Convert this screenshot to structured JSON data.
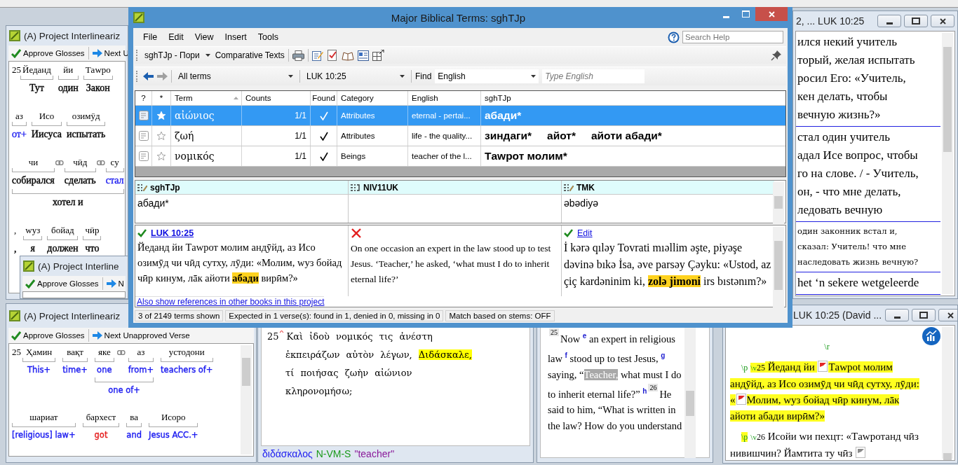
{
  "interlinear_windows": [
    {
      "title": "(A) Project Interlineariz",
      "toolbar": [
        {
          "kind": "approve",
          "label": "Approve Glosses"
        },
        {
          "kind": "next",
          "label": "Next U"
        }
      ],
      "rows": [
        {
          "verse": "25",
          "items": [
            {
              "kind": "word",
              "text": "Йеданд",
              "gloss": "Тут",
              "color": "#000000",
              "linked": false
            },
            {
              "kind": "word",
              "text": "йи",
              "gloss": "один",
              "color": "#000000",
              "linked": false
            },
            {
              "kind": "word",
              "text": "Тawpo",
              "gloss": "Закон",
              "color": "#000000",
              "linked": false
            }
          ]
        },
        {
          "items": [
            {
              "kind": "word",
              "text": "аз",
              "gloss": "от+",
              "color": "#1c1cf0",
              "linked": false
            },
            {
              "kind": "word",
              "text": "Исо",
              "gloss": "Иисуса",
              "color": "#000000",
              "linked": false
            },
            {
              "kind": "word",
              "text": "озимӯд",
              "gloss": "испытать",
              "color": "#000000",
              "linked": false
            }
          ]
        },
        {
          "items": [
            {
              "kind": "phrase",
              "gloss": "хотел и",
              "color": "#000000",
              "words": [
                {
                  "kind": "word",
                  "text": "чи",
                  "gloss": "собирался",
                  "color": "#000000",
                  "linked": true
                },
                {
                  "kind": "word",
                  "text": "чӣд",
                  "gloss": "сделать",
                  "color": "#000000",
                  "linked": true
                },
                {
                  "kind": "word",
                  "text": "су",
                  "gloss": "стал",
                  "color": "#1c1cf0",
                  "linked": false
                }
              ]
            }
          ]
        },
        {
          "items": [
            {
              "kind": "punct",
              "text": ",",
              "gloss": ",",
              "linked": false
            },
            {
              "kind": "word",
              "text": "wуз",
              "gloss": "я",
              "color": "#000000",
              "linked": false
            },
            {
              "kind": "word",
              "text": "бойад",
              "gloss": "должен",
              "color": "#000000",
              "linked": false
            },
            {
              "kind": "word",
              "text": "чӣр",
              "gloss": "что",
              "color": "#000000",
              "linked": false
            }
          ]
        }
      ]
    },
    {
      "title": "(A) Project Interline",
      "toolbar": [
        {
          "kind": "approve",
          "label": "Approve Glosses"
        },
        {
          "kind": "next",
          "label": "N"
        }
      ]
    },
    {
      "title": "(A) Project Interlineariz",
      "toolbar": [
        {
          "kind": "approve",
          "label": "Approve Glosses"
        },
        {
          "kind": "next",
          "label": "Next Unapproved Verse"
        }
      ],
      "rows": [
        {
          "verse": "25",
          "items": [
            {
              "kind": "word",
              "text": "Ҳамин",
              "gloss": "This+",
              "color": "#1c1cf0",
              "linked": false
            },
            {
              "kind": "word",
              "text": "вақт",
              "gloss": "time+",
              "color": "#1c1cf0",
              "linked": false
            },
            {
              "kind": "phrase",
              "gloss": "one of+",
              "color": "#1c1cf0",
              "words": [
                {
                  "kind": "word",
                  "text": "яке",
                  "gloss": "one",
                  "color": "#1c1cf0",
                  "linked": true
                },
                {
                  "kind": "word",
                  "text": "аз",
                  "gloss": "from+",
                  "color": "#1c1cf0",
                  "linked": false
                }
              ]
            },
            {
              "kind": "word",
              "text": "устодони",
              "gloss": "teachers of+",
              "color": "#1c1cf0",
              "linked": false
            }
          ]
        },
        {
          "items": [
            {
              "kind": "word",
              "text": "шариат",
              "gloss": "[religious] law+",
              "color": "#1c1cf0",
              "linked": false
            },
            {
              "kind": "word",
              "text": "бархест",
              "gloss": "got",
              "color": "#e52020",
              "linked": false
            },
            {
              "kind": "word",
              "text": "ва",
              "gloss": "and",
              "color": "#1c1cf0",
              "linked": false
            },
            {
              "kind": "word",
              "text": "Исоро",
              "gloss": "Jesus ACC.+",
              "color": "#1c1cf0",
              "linked": false
            }
          ]
        }
      ]
    }
  ],
  "greek_window": {
    "verse": "25",
    "segments": [
      {
        "text": "Καὶ ἰδοὺ νομικός τις ἀνέστη ἐκπειράζων αὐτὸν λέγων, ",
        "highlighted": false
      },
      {
        "text": "Διδάσκαλε,",
        "highlighted": true
      },
      {
        "text": " τί ποιήσας ζωὴν αἰώνιον κληρονομήσω;",
        "highlighted": false
      }
    ],
    "lexicon": [
      {
        "kind": "lemma",
        "text": "διδάσκαλος"
      },
      {
        "kind": "parsing",
        "text": "N-VM-S"
      },
      {
        "kind": "gloss",
        "text": "\"teacher\""
      }
    ]
  },
  "english_window": {
    "segments": [
      {
        "kind": "verse",
        "text": "25"
      },
      {
        "kind": "text",
        "text": "Now "
      },
      {
        "kind": "note",
        "text": "e"
      },
      {
        "kind": "text",
        "text": " an expert in religious law "
      },
      {
        "kind": "note",
        "text": "f"
      },
      {
        "kind": "text",
        "text": " stood up to test Jesus, "
      },
      {
        "kind": "note",
        "text": "g"
      },
      {
        "kind": "text",
        "text": " saying, “"
      },
      {
        "kind": "selection",
        "text": "Teacher,"
      },
      {
        "kind": "text",
        "text": " what must I do to inherit eternal life?” "
      },
      {
        "kind": "note",
        "text": "h"
      },
      {
        "kind": "verse",
        "text": "26"
      },
      {
        "kind": "text",
        "text": "He said to him, “What is written in the law? How do you understand"
      }
    ]
  },
  "compare_window": {
    "title": "2, ... LUK 10:25",
    "blocks": [
      {
        "kind": "large",
        "lines": [
          "ился некий учитель",
          "торый, желая испытать",
          "росил Его: «Учитель,",
          "кен делать, чтобы",
          "вечную жизнь?»"
        ]
      },
      {
        "kind": "large",
        "lines": [
          "стал один учитель",
          "адал Исе вопрос, чтобы",
          "го на слове. / - Учитель,",
          "он, - что мне делать,",
          "ледовать вечную"
        ]
      },
      {
        "kind": "small",
        "lines": [
          "один законник встал и,",
          "сказал: Учитель! что мне",
          "наследовать жизнь вечную?"
        ]
      },
      {
        "kind": "large",
        "lines": [
          "het ‘n sekere wetgeleerde"
        ]
      }
    ]
  },
  "editor_window": {
    "title": "LUK 10:25 (David ...",
    "paragraphs": [
      {
        "kind": "heading",
        "segments": [
          {
            "kind": "marker",
            "text": "\\r",
            "highlighted": false
          }
        ]
      },
      {
        "kind": "para",
        "segments": [
          {
            "kind": "marker",
            "text": "\\p",
            "highlighted": false
          },
          {
            "kind": "verse",
            "marker": "\\v",
            "text": "25",
            "highlighted": true
          },
          {
            "kind": "text",
            "text": " Йеданд йи ",
            "highlighted": true
          },
          {
            "kind": "flag",
            "color": "#e32626"
          },
          {
            "kind": "text",
            "text": "Тawpot молим андӯйд, аз Исо озимӯд чи чӣд сутху, лӯди: «",
            "highlighted": true
          },
          {
            "kind": "flag",
            "color": "#e32626"
          },
          {
            "kind": "text",
            "text": "Молим, wуз бойад чӣр кинум, лāк айоти абади вирӣм?»",
            "highlighted": true
          }
        ]
      },
      {
        "kind": "para",
        "segments": [
          {
            "kind": "marker",
            "text": "\\p",
            "highlighted": true
          },
          {
            "kind": "verse",
            "marker": "\\v",
            "text": "26",
            "highlighted": false
          },
          {
            "kind": "text",
            "text": " Исойи wи пехцт: «Тawpотанд чӣз нивишчин? Йамтита ту чӣз ",
            "highlighted": false
          },
          {
            "kind": "flag",
            "color": "#8a8a8a"
          }
        ]
      }
    ]
  },
  "dialog": {
    "title": "Major Biblical Terms: sghTJp",
    "menu": [
      "File",
      "Edit",
      "View",
      "Insert",
      "Tools"
    ],
    "search": {
      "placeholder": "Search Help"
    },
    "project_dropdown": "sghTJp - Пори",
    "comparative": "Comparative Texts",
    "filter": "All terms",
    "reference": "LUK 10:25",
    "find_label": "Find",
    "find_language": "English",
    "find_field": {
      "placeholder": "Type English"
    },
    "columns": [
      "?",
      "*",
      "Term",
      "Counts",
      "Found",
      "Category",
      "English",
      "sghTJp"
    ],
    "rows": [
      {
        "selected": true,
        "starred": true,
        "term": "αἰώνιος",
        "counts": "1/1",
        "found": true,
        "category": "Attributes",
        "english": "eternal - pertai...",
        "renderings": [
          "абади*"
        ]
      },
      {
        "selected": false,
        "starred": false,
        "term": "ζωή",
        "counts": "1/1",
        "found": true,
        "category": "Attributes",
        "english": "life - the quality...",
        "renderings": [
          "зиндаги*",
          "айот*",
          "айоти абади*"
        ]
      },
      {
        "selected": false,
        "starred": false,
        "term": "νομικός",
        "counts": "1/1",
        "found": true,
        "category": "Beings",
        "english": "teacher of the l...",
        "renderings": [
          "Тawpот молим*"
        ]
      }
    ],
    "rendering_columns": [
      {
        "name": "sghTJp",
        "editable": true,
        "values": [
          "абади*"
        ]
      },
      {
        "name": "NIV11UK",
        "editable": false
      },
      {
        "name": "TMK",
        "editable": true,
        "values": [
          "əbədiyə"
        ]
      }
    ],
    "verse_columns": [
      {
        "approved": true,
        "link": "LUK 10:25",
        "segments": [
          {
            "text": "Йеданд йи Тawpот молим андӯйд, аз Исо озимӯд чи чӣд сутху, лӯди: «Молим, wуз бойад чӣр кинум, лāк айоти ",
            "highlighted": false
          },
          {
            "text": "абади",
            "highlighted": true
          },
          {
            "text": " вирӣм?»",
            "highlighted": false
          }
        ]
      },
      {
        "approved": false,
        "segments": [
          {
            "text": "On one occasion an expert in the law stood up to test Jesus. ‘Teacher,’ he asked, ‘what must I do to inherit eternal life?’",
            "highlighted": false
          }
        ]
      },
      {
        "approved": true,
        "link": "Edit",
        "segments": [
          {
            "text": "İ kərə qılǝy Tovrati mıəllim əşte, piyəşe dəvinə bıkə İsa, əve parsəy Çəyku: «Ustod, az çiç kardəninim ki, ",
            "highlighted": false
          },
          {
            "text": "zolə jimoni",
            "highlighted": true
          },
          {
            "text": " irs bıstənım?»",
            "highlighted": false
          }
        ]
      }
    ],
    "other_books_link": "Also show references in other books in this project",
    "status_bar": [
      "3 of 2149 terms shown",
      "Expected in 1 verse(s): found in 1, denied in 0, missing in 0",
      "Match based on stems: OFF"
    ]
  }
}
